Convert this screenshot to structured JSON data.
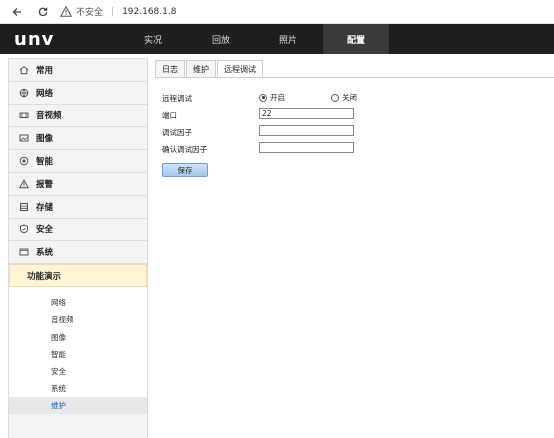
{
  "browser": {
    "insecure_label": "不安全",
    "separator": "|",
    "url": "192.168.1.8"
  },
  "header": {
    "logo": "unv",
    "tabs": [
      {
        "label": "实况"
      },
      {
        "label": "回放"
      },
      {
        "label": "照片"
      },
      {
        "label": "配置"
      }
    ]
  },
  "sidebar": {
    "items": [
      {
        "label": "常用",
        "icon": "home-icon"
      },
      {
        "label": "网络",
        "icon": "globe-icon"
      },
      {
        "label": "音视频",
        "icon": "video-icon"
      },
      {
        "label": "图像",
        "icon": "image-icon"
      },
      {
        "label": "智能",
        "icon": "smart-icon"
      },
      {
        "label": "报警",
        "icon": "alarm-icon"
      },
      {
        "label": "存储",
        "icon": "storage-icon"
      },
      {
        "label": "安全",
        "icon": "shield-icon"
      },
      {
        "label": "系统",
        "icon": "system-icon"
      }
    ],
    "sub_header": "功能演示",
    "sub_items": [
      {
        "label": "网络"
      },
      {
        "label": "音视频"
      },
      {
        "label": "图像"
      },
      {
        "label": "智能"
      },
      {
        "label": "安全"
      },
      {
        "label": "系统"
      },
      {
        "label": "维护"
      }
    ]
  },
  "main": {
    "tabs": [
      {
        "label": "日志"
      },
      {
        "label": "维护"
      },
      {
        "label": "远程调试"
      }
    ],
    "form": {
      "remote_debug_label": "远程调试",
      "on_label": "开启",
      "off_label": "关闭",
      "port_label": "端口",
      "port_value": "22",
      "factor_label": "调试因子",
      "factor_value": "",
      "confirm_label": "确认调试因子",
      "confirm_value": "",
      "save_label": "保存"
    }
  }
}
